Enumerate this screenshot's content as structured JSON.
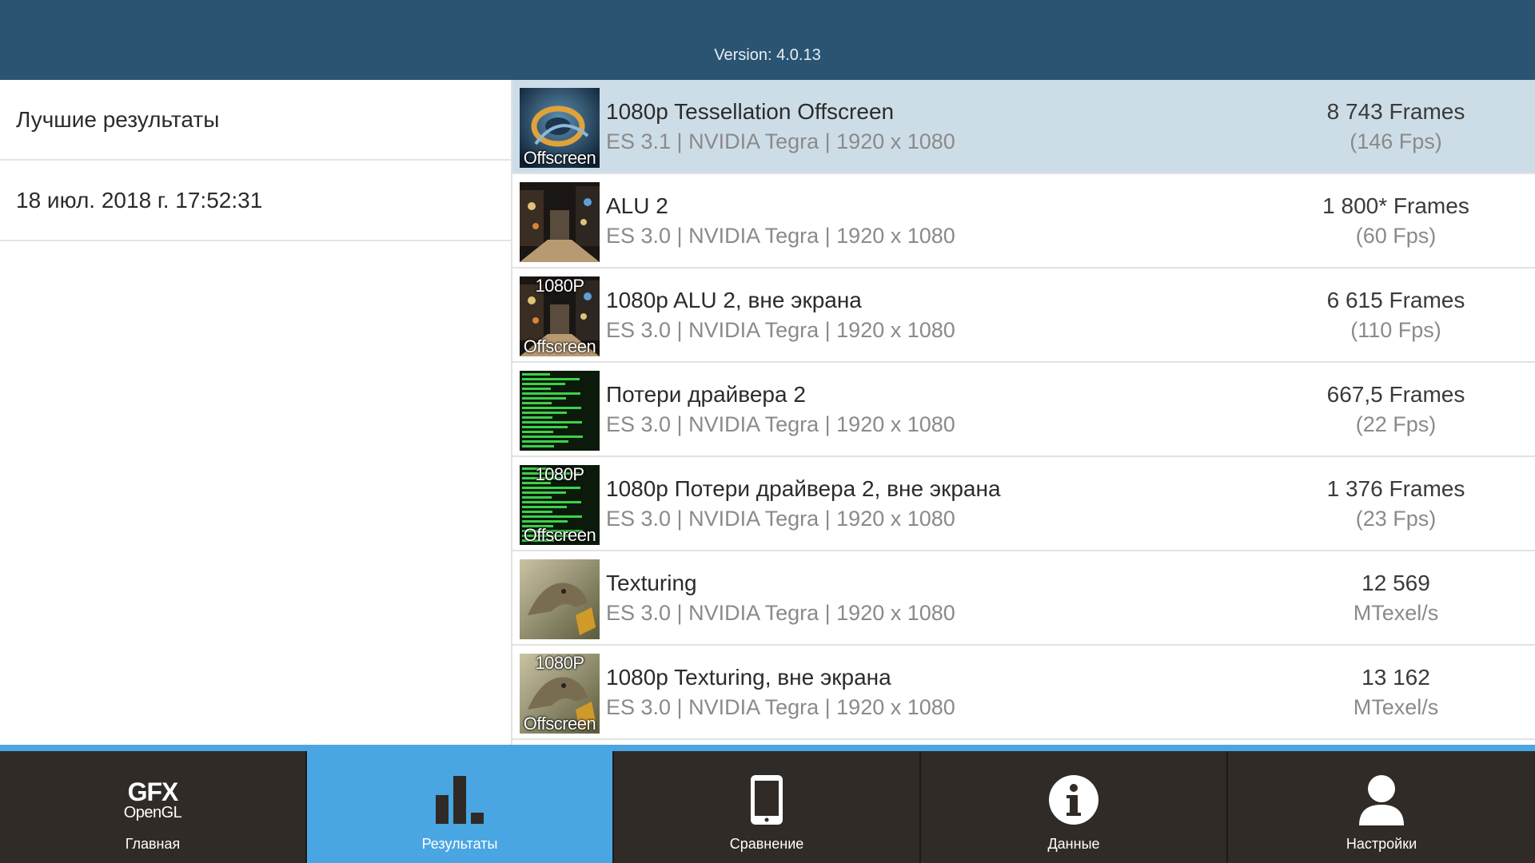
{
  "header": {
    "version": "Version: 4.0.13"
  },
  "left_panel": {
    "title": "Лучшие результаты",
    "date": "18 июл. 2018 г. 17:52:31"
  },
  "results": [
    {
      "title": "1080p Tessellation Offscreen",
      "subtitle": "ES 3.1 | NVIDIA Tegra | 1920 x 1080",
      "score": "8 743 Frames",
      "score_sub": "(146 Fps)",
      "thumb_top": "",
      "thumb_bottom": "Offscreen",
      "thumb_style": "tess",
      "selected": true
    },
    {
      "title": "ALU 2",
      "subtitle": "ES 3.0 | NVIDIA Tegra | 1920 x 1080",
      "score": "1 800* Frames",
      "score_sub": "(60 Fps)",
      "thumb_top": "",
      "thumb_bottom": "",
      "thumb_style": "alu",
      "selected": false
    },
    {
      "title": "1080p ALU 2, вне экрана",
      "subtitle": "ES 3.0 | NVIDIA Tegra | 1920 x 1080",
      "score": "6 615 Frames",
      "score_sub": "(110 Fps)",
      "thumb_top": "1080P",
      "thumb_bottom": "Offscreen",
      "thumb_style": "alu",
      "selected": false
    },
    {
      "title": "Потери драйвера 2",
      "subtitle": "ES 3.0 | NVIDIA Tegra | 1920 x 1080",
      "score": "667,5 Frames",
      "score_sub": "(22 Fps)",
      "thumb_top": "",
      "thumb_bottom": "",
      "thumb_style": "driver",
      "selected": false
    },
    {
      "title": "1080p Потери драйвера 2, вне экрана",
      "subtitle": "ES 3.0 | NVIDIA Tegra | 1920 x 1080",
      "score": "1 376 Frames",
      "score_sub": "(23 Fps)",
      "thumb_top": "1080P",
      "thumb_bottom": "Offscreen",
      "thumb_style": "driver",
      "selected": false
    },
    {
      "title": "Texturing",
      "subtitle": "ES 3.0 | NVIDIA Tegra | 1920 x 1080",
      "score": "12 569",
      "score_sub": "MTexel/s",
      "thumb_top": "",
      "thumb_bottom": "",
      "thumb_style": "texture",
      "selected": false
    },
    {
      "title": "1080p Texturing, вне экрана",
      "subtitle": "ES 3.0 | NVIDIA Tegra | 1920 x 1080",
      "score": "13 162",
      "score_sub": "MTexel/s",
      "thumb_top": "1080P",
      "thumb_bottom": "Offscreen",
      "thumb_style": "texture",
      "selected": false
    }
  ],
  "nav": [
    {
      "label": "Главная",
      "icon": "gfx-opengl-logo",
      "logo_top": "GFX",
      "logo_bottom": "OpenGL",
      "active": false
    },
    {
      "label": "Результаты",
      "icon": "bar-chart-icon",
      "active": true
    },
    {
      "label": "Сравнение",
      "icon": "phone-icon",
      "active": false
    },
    {
      "label": "Данные",
      "icon": "info-icon",
      "active": false
    },
    {
      "label": "Настройки",
      "icon": "user-icon",
      "active": false
    }
  ],
  "colors": {
    "header": "#2b5473",
    "selected_row": "#cddde8",
    "nav_bg": "#302b26",
    "nav_active": "#4aa6e3"
  }
}
